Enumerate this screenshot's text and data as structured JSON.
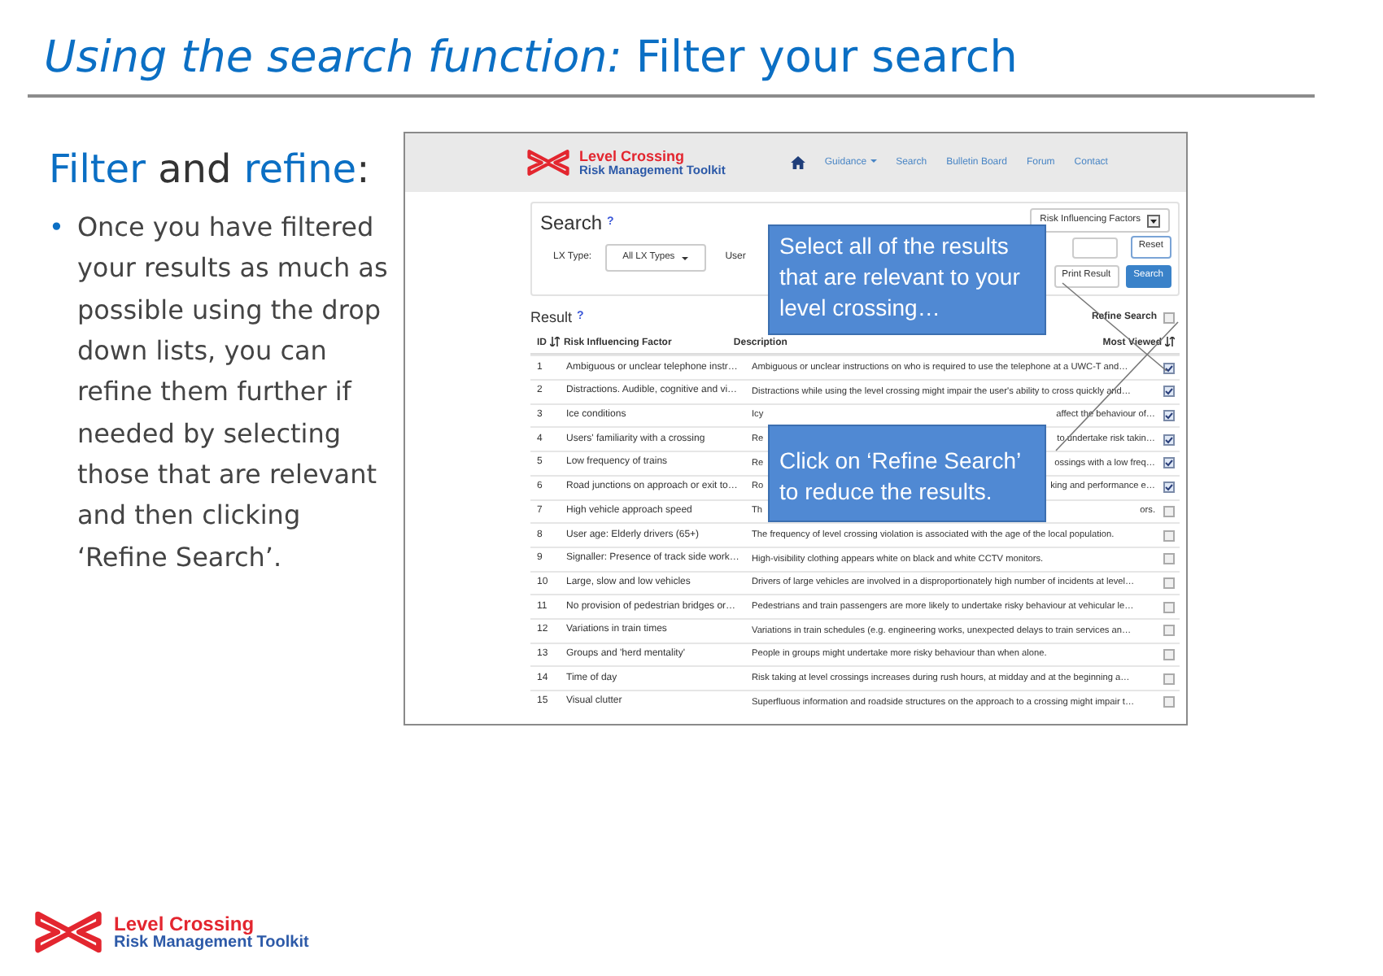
{
  "slide": {
    "title": "*Using the search function:* Filter your search",
    "heading": [
      {
        "text": "Filter",
        "accent": true
      },
      {
        "text": " and ",
        "accent": false
      },
      {
        "text": "refine",
        "accent": true
      },
      {
        "text": ":",
        "accent": false
      }
    ],
    "bullet_mark": "•",
    "bullets": [
      "Once you have filtered your results as much as possible using the drop down lists, you can refine them further if needed by selecting those that are relevant and then clicking ‘Refine Search’."
    ],
    "footer_logo": {
      "line_1": "Level Crossing",
      "line_2": "Risk Management Toolkit"
    }
  },
  "app": {
    "brand": {
      "line_1": "Level Crossing",
      "line_2": "Risk Management Toolkit"
    },
    "nav": [
      {
        "label": "Guidance",
        "dropdown": true
      },
      {
        "label": "Search",
        "dropdown": false
      },
      {
        "label": "Bulletin Board",
        "dropdown": false
      },
      {
        "label": "Forum",
        "dropdown": false
      },
      {
        "label": "Contact",
        "dropdown": false
      }
    ],
    "search": {
      "title": "Search",
      "help": "?",
      "factor_select": "Risk Influencing Factors",
      "lx_label": "LX Type:",
      "lx_select": "All LX Types",
      "user_label": "User",
      "buttons": [
        {
          "label": "Reset",
          "kind": "outline"
        },
        {
          "label": "Print Result",
          "kind": "plain"
        },
        {
          "label": "Search",
          "kind": "primary"
        }
      ]
    },
    "result": {
      "title": "Result",
      "help": "?",
      "refine_label": "Refine Search",
      "refine_checked": false
    },
    "columns": [
      {
        "label": "ID",
        "sortable": true
      },
      {
        "label": "Risk Influencing Factor",
        "sortable": false
      },
      {
        "label": "Description",
        "sortable": false
      },
      {
        "label": "Most Viewed",
        "sortable": true
      }
    ],
    "rows": [
      {
        "id": "1",
        "factor": "Ambiguous or unclear telephone instr…",
        "description": "Ambiguous or unclear instructions on who is required to use the telephone at a UWC-T and…",
        "checked": true
      },
      {
        "id": "2",
        "factor": "Distractions. Audible, cognitive and vi…",
        "description": "Distractions while using the level crossing might impair the user's ability to cross quickly and…",
        "checked": true
      },
      {
        "id": "3",
        "factor": "Ice conditions",
        "description": "Icy",
        "description_end": "affect the behaviour of…",
        "checked": true
      },
      {
        "id": "4",
        "factor": "Users' familiarity with a crossing",
        "description": "Re",
        "description_end": "to undertake risk takin…",
        "checked": true
      },
      {
        "id": "5",
        "factor": "Low frequency of trains",
        "description": "Re",
        "description_end": "ossings with a low freq…",
        "checked": true
      },
      {
        "id": "6",
        "factor": "Road junctions on approach or exit to…",
        "description": "Ro",
        "description_end": "king and performance e…",
        "checked": true
      },
      {
        "id": "7",
        "factor": "High vehicle approach speed",
        "description": "Th",
        "description_end": "ors.",
        "checked": false
      },
      {
        "id": "8",
        "factor": "User age: Elderly drivers (65+)",
        "description": "The frequency of level crossing violation is associated with the age of the local population.",
        "checked": false
      },
      {
        "id": "9",
        "factor": "Signaller: Presence of track side work…",
        "description": "High-visibility clothing appears white on black and white CCTV monitors.",
        "checked": false
      },
      {
        "id": "10",
        "factor": "Large, slow and low vehicles",
        "description": "Drivers of large vehicles are involved in a disproportionately high number of incidents at level…",
        "checked": false
      },
      {
        "id": "11",
        "factor": "No provision of pedestrian bridges or…",
        "description": "Pedestrians and train passengers are more likely to undertake risky behaviour at vehicular le…",
        "checked": false
      },
      {
        "id": "12",
        "factor": "Variations in train times",
        "description": "Variations in train schedules (e.g. engineering works, unexpected delays to train services an…",
        "checked": false
      },
      {
        "id": "13",
        "factor": "Groups and 'herd mentality'",
        "description": "People in groups might undertake more risky behaviour than when alone.",
        "checked": false
      },
      {
        "id": "14",
        "factor": "Time of day",
        "description": "Risk taking at level crossings increases during rush hours, at midday and at the beginning a…",
        "checked": false
      },
      {
        "id": "15",
        "factor": "Visual clutter",
        "description": "Superfluous information and roadside structures on the approach to a crossing might impair t…",
        "checked": false
      }
    ]
  },
  "callouts": [
    "Select all of the results that are relevant to your level crossing…",
    "Click on ‘Refine Search’ to reduce the results."
  ]
}
